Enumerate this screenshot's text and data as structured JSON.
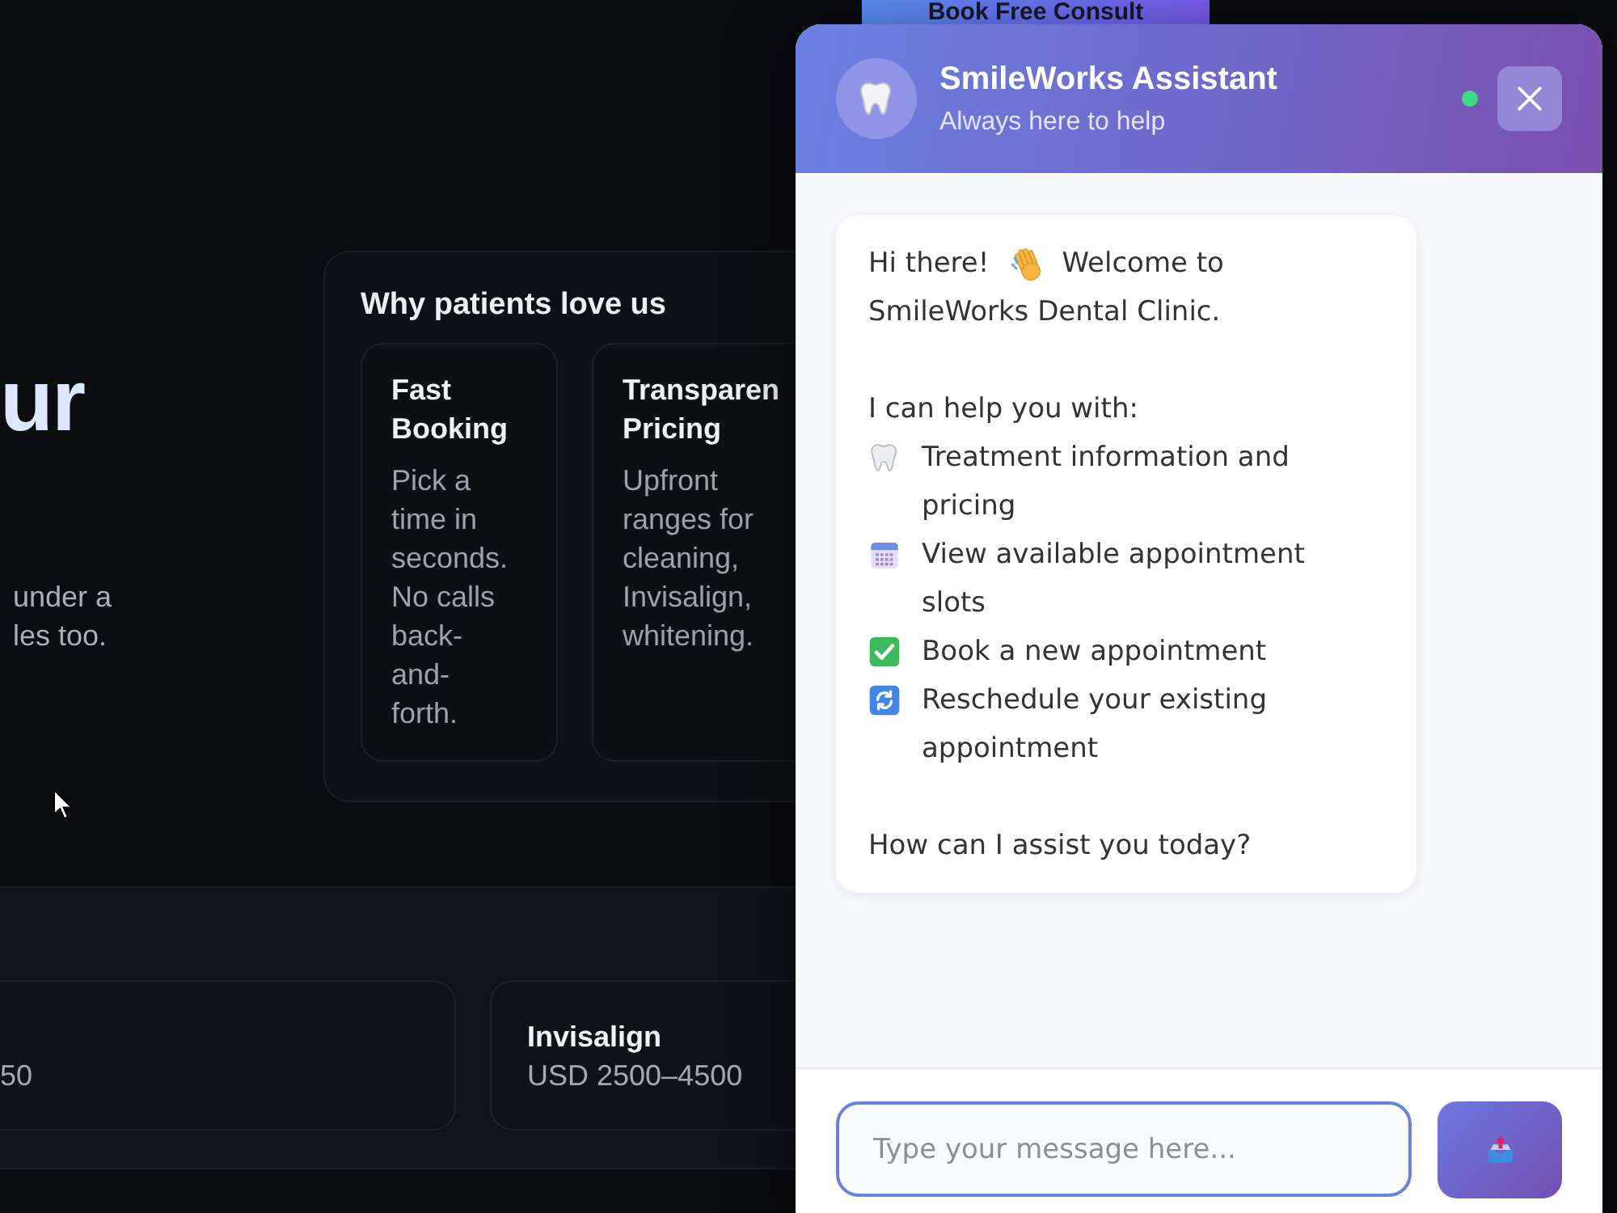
{
  "page": {
    "nav_button": "Book Free Consult",
    "hero": {
      "heading": "ur",
      "text": "under a les too."
    },
    "features": {
      "title": "Why patients love us",
      "cards": [
        {
          "title": "Fast Booking",
          "text": "Pick a time in seconds. No calls back-and-forth."
        },
        {
          "title": "Transparen Pricing",
          "text": "Upfront ranges for cleaning, Invisalign, whitening."
        }
      ]
    },
    "prices": [
      {
        "price": "50"
      },
      {
        "name": "Invisalign",
        "price": "USD 2500–4500"
      }
    ]
  },
  "chat": {
    "title": "SmileWorks Assistant",
    "subtitle": "Always here to help",
    "online": true,
    "message": {
      "greeting": "Hi there!",
      "welcome_lines": [
        "Welcome to",
        "SmileWorks Dental Clinic."
      ],
      "intro": "I can help you with:",
      "items": [
        {
          "kind": "treatments",
          "text": "Treatment information and pricing"
        },
        {
          "kind": "slots",
          "text": "View available appointment slots"
        },
        {
          "kind": "booking",
          "text": "Book a new appointment"
        },
        {
          "kind": "reschedule",
          "text": "Reschedule your existing appointment"
        }
      ],
      "closing": "How can I assist you today?"
    },
    "input": {
      "placeholder": "Type your message here..."
    }
  }
}
